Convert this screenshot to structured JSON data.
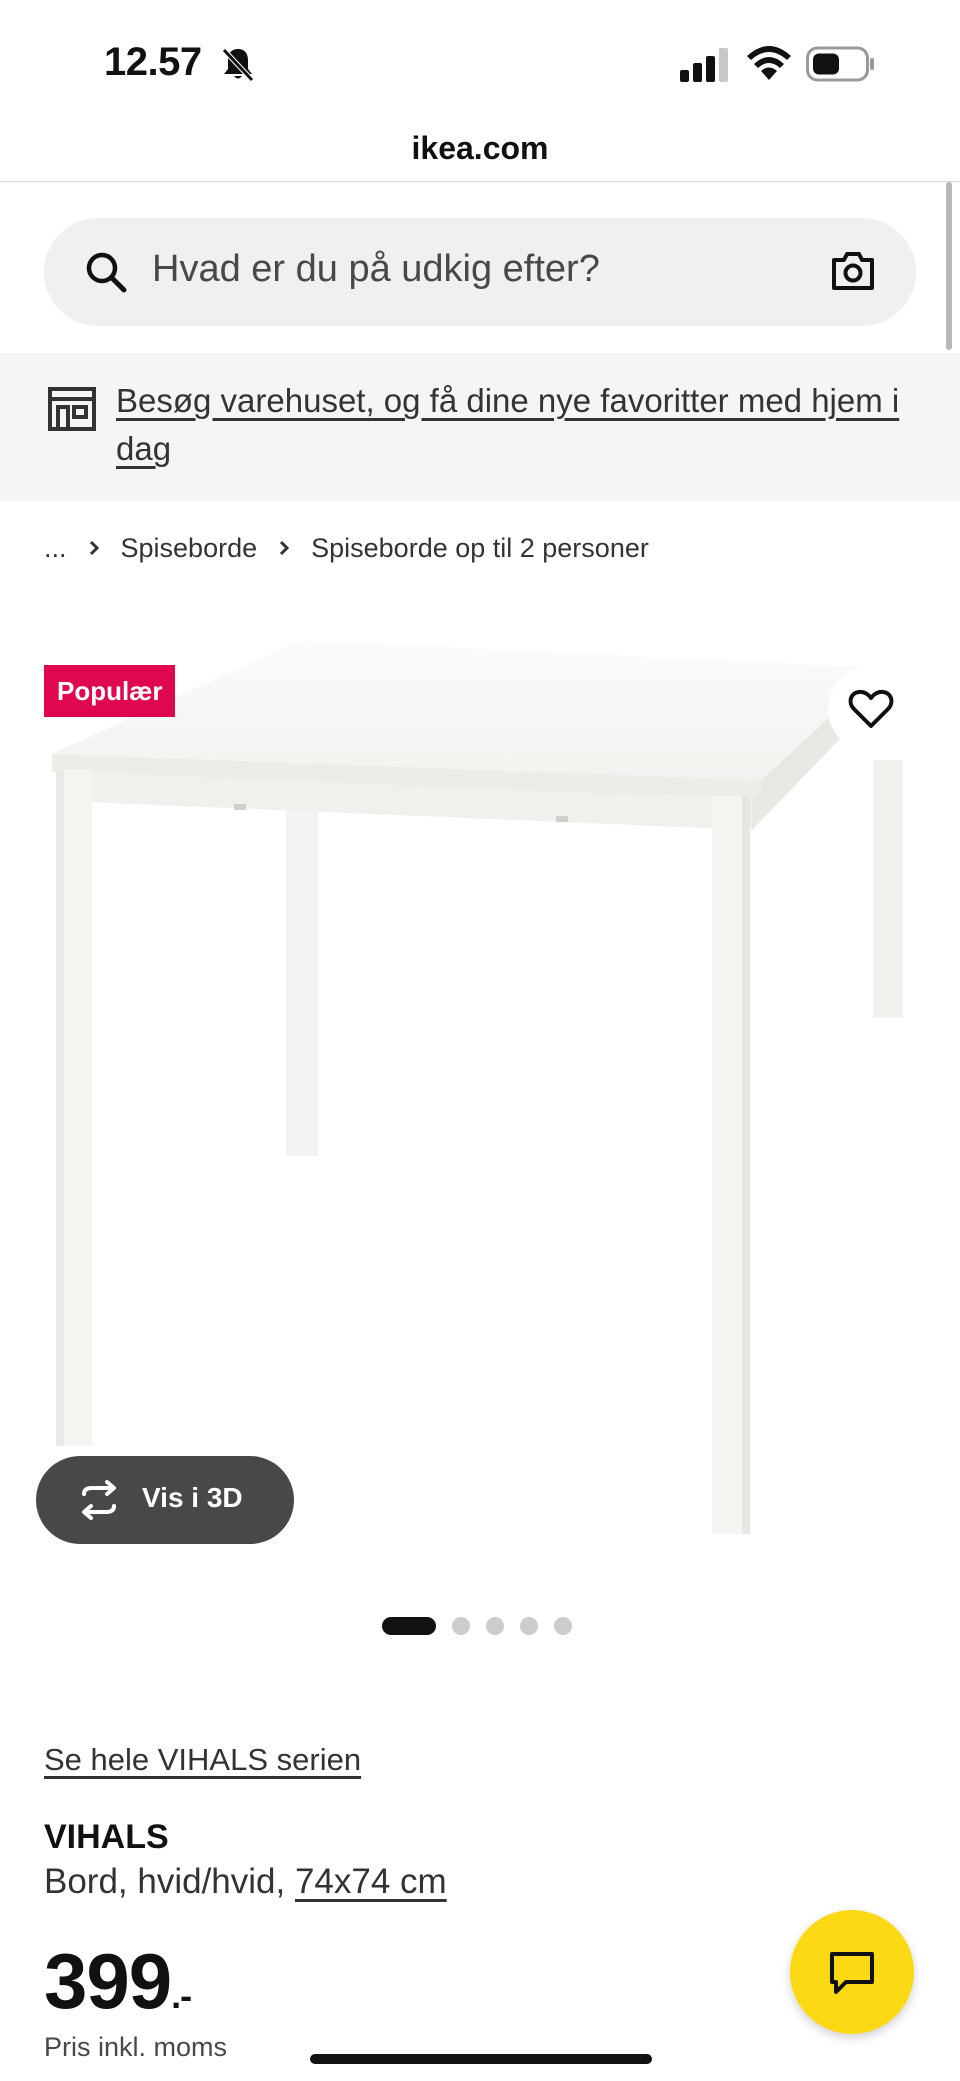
{
  "status_bar": {
    "time": "12.57",
    "icons": [
      "bell-slash-icon",
      "signal-icon",
      "wifi-icon",
      "battery-icon"
    ]
  },
  "browser": {
    "url": "ikea.com"
  },
  "search": {
    "placeholder": "Hvad er du på udkig efter?",
    "icons": [
      "search-icon",
      "camera-icon"
    ]
  },
  "store_banner": {
    "text": "Besøg varehuset, og få dine nye favoritter med hjem i dag",
    "icon": "store-icon"
  },
  "breadcrumb": {
    "items": [
      "...",
      "Spiseborde",
      "Spiseborde op til 2 personer"
    ]
  },
  "product_gallery": {
    "badge": "Populær",
    "view_3d_label": "Vis i 3D",
    "image_count": 5,
    "active_image_index": 0
  },
  "product": {
    "series_link": "Se hele VIHALS serien",
    "name": "VIHALS",
    "description": "Bord, hvid/hvid, ",
    "size": "74x74 cm",
    "price": "399",
    "price_suffix": ".-",
    "price_note": "Pris inkl. moms"
  },
  "colors": {
    "badge_bg": "#e00751",
    "chat_button_bg": "#fbd914",
    "view3d_bg": "#484848"
  }
}
